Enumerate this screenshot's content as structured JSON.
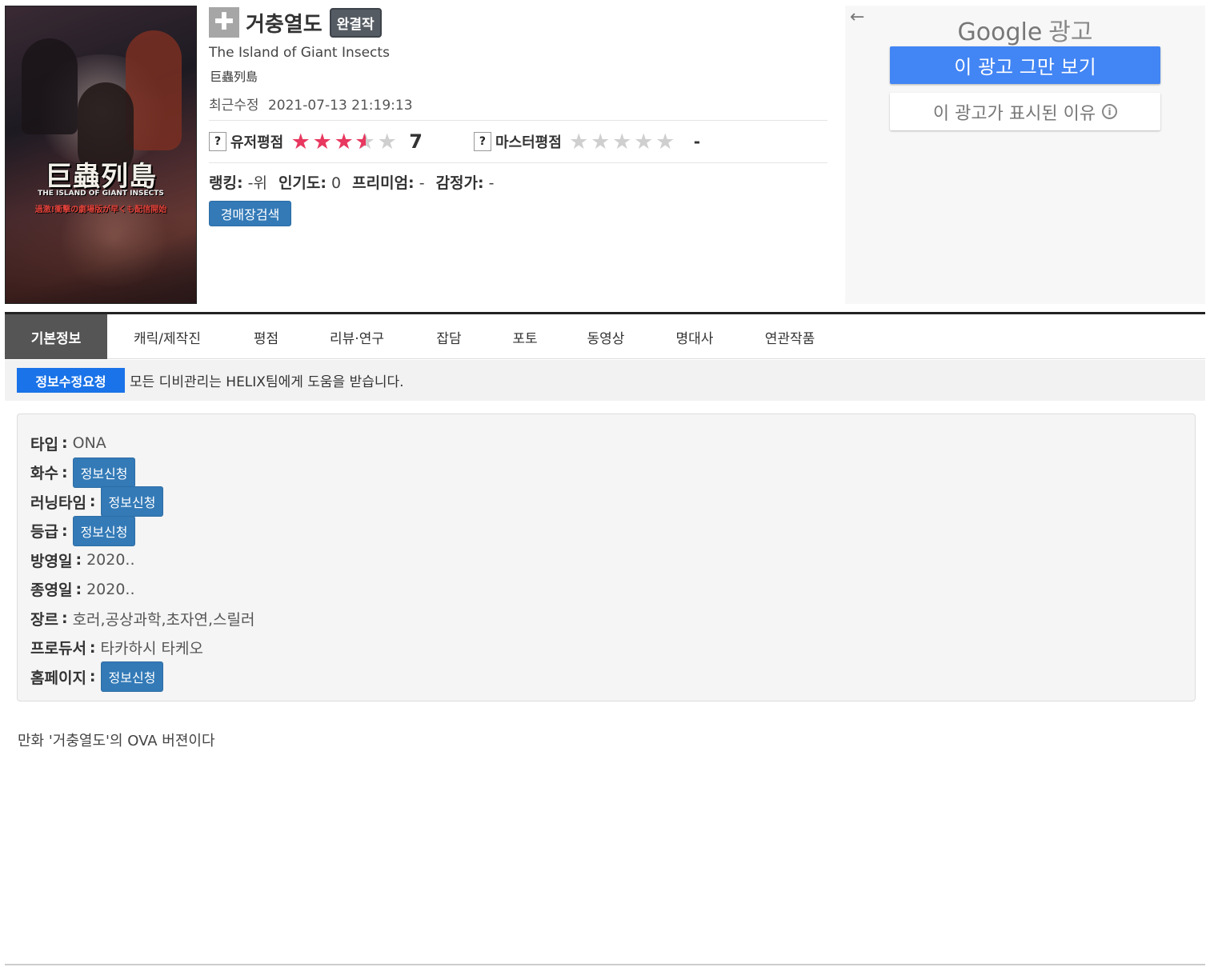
{
  "poster": {
    "logo_jp": "巨蟲列島",
    "logo_en": "THE ISLAND OF GIANT INSECTS",
    "logo_sub": "過激!衝撃の劇場版が早くも配信開始"
  },
  "header": {
    "plus_icon": "plus-icon",
    "title": "거충열도",
    "status_badge": "완결작",
    "title_en": "The Island of Giant Insects",
    "title_jp": "巨蟲列島",
    "updated_label": "최근수정",
    "updated_value": "2021-07-13 21:19:13"
  },
  "ratings": {
    "user_label": "유저평점",
    "user_value": "7",
    "user_stars": 3.5,
    "master_label": "마스터평점",
    "master_value": "-",
    "master_stars": 0,
    "star_on_color": "#e8385f",
    "star_off_color": "#cfcfcf"
  },
  "stats": {
    "ranking_label": "랭킹:",
    "ranking_value": "-위",
    "popularity_label": "인기도:",
    "popularity_value": "0",
    "premium_label": "프리미엄:",
    "premium_value": "-",
    "appraiser_label": "감정가:",
    "appraiser_value": "-",
    "auction_button": "경매장검색"
  },
  "ad": {
    "back_icon": "arrow-left-icon",
    "google": "Google",
    "ad_label": "광고",
    "stop_button": "이 광고 그만 보기",
    "why_button": "이 광고가 표시된 이유",
    "info_icon": "info-icon"
  },
  "tabs": [
    {
      "label": "기본정보",
      "active": true
    },
    {
      "label": "캐릭/제작진"
    },
    {
      "label": "평점"
    },
    {
      "label": "리뷰·연구"
    },
    {
      "label": "잡담"
    },
    {
      "label": "포토"
    },
    {
      "label": "동영상"
    },
    {
      "label": "명대사"
    },
    {
      "label": "연관작품"
    }
  ],
  "notice": {
    "edit_request": "정보수정요청",
    "text": "모든 디비관리는 HELIX팀에게 도움을 받습니다."
  },
  "info": {
    "type_label": "타입",
    "type_value": "ONA",
    "episodes_label": "화수",
    "runtime_label": "러닝타임",
    "rating_label": "등급",
    "aired_label": "방영일",
    "aired_value": "2020..",
    "ended_label": "종영일",
    "ended_value": "2020..",
    "genre_label": "장르",
    "genre_value": "호러,공상과학,초자연,스릴러",
    "producer_label": "프로듀서",
    "producer_value": "타카하시 타케오",
    "homepage_label": "홈페이지",
    "request_button": "정보신청"
  },
  "synopsis": "만화 '거충열도'의 OVA 버젼이다"
}
